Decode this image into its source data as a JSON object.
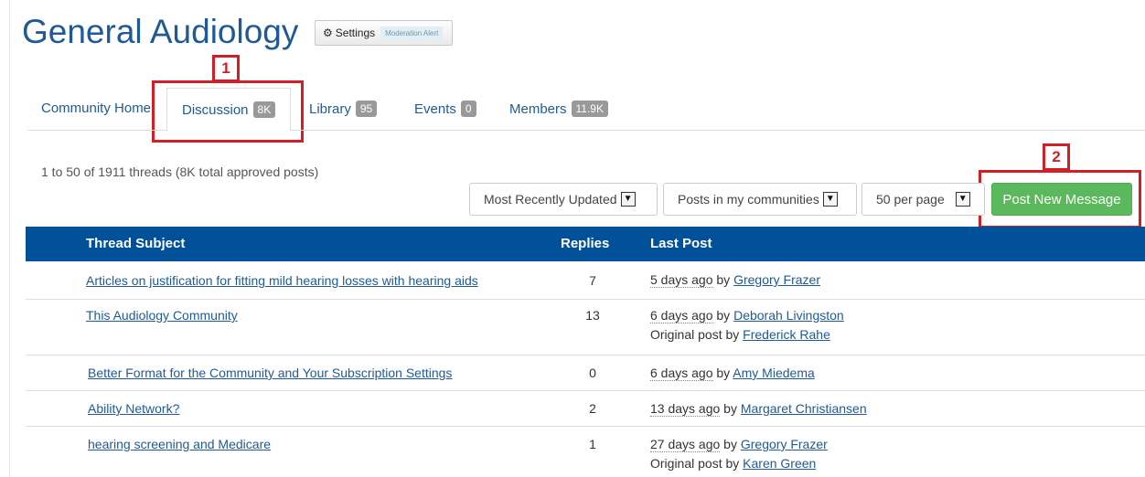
{
  "header": {
    "title": "General Audiology",
    "settings_label": "Settings",
    "moderation_badge": "Moderation Alert"
  },
  "annotations": [
    "1",
    "2"
  ],
  "tabs": [
    {
      "label": "Community Home"
    },
    {
      "label": "Discussion",
      "count": "8K"
    },
    {
      "label": "Library",
      "count": "95"
    },
    {
      "label": "Events",
      "count": "0"
    },
    {
      "label": "Members",
      "count": "11.9K"
    }
  ],
  "summary": "1 to 50 of 1911 threads (8K total approved posts)",
  "controls": {
    "sort": "Most Recently Updated",
    "scope": "Posts in my communities",
    "per_page": "50 per page",
    "post_button": "Post New Message"
  },
  "table": {
    "headers": [
      "Thread Subject",
      "Replies",
      "Last Post"
    ],
    "rows": [
      {
        "subject": "Articles on justification for fitting mild hearing losses with hearing aids",
        "replies": "7",
        "ago": "5 days ago",
        "by": " by ",
        "user": "Gregory Frazer"
      },
      {
        "subject": "This Audiology Community",
        "replies": "13",
        "ago": "6 days ago",
        "by": " by ",
        "user": "Deborah Livingston",
        "orig_prefix": "Original post by ",
        "orig_user": "Frederick Rahe"
      },
      {
        "subject": "Better Format for the Community and Your Subscription Settings",
        "replies": "0",
        "ago": "6 days ago",
        "by": " by ",
        "user": "Amy Miedema"
      },
      {
        "subject": "Ability Network?",
        "replies": "2",
        "ago": "13 days ago",
        "by": " by ",
        "user": "Margaret Christiansen"
      },
      {
        "subject": "hearing screening and Medicare",
        "replies": "1",
        "ago": "27 days ago",
        "by": " by ",
        "user": "Gregory Frazer",
        "orig_prefix": "Original post by ",
        "orig_user": "Karen Green"
      }
    ]
  },
  "colors": {
    "accent": "#1f5a96",
    "header_bar": "#00519a",
    "post_button": "#5cb85c",
    "annotation": "#d11f26"
  }
}
